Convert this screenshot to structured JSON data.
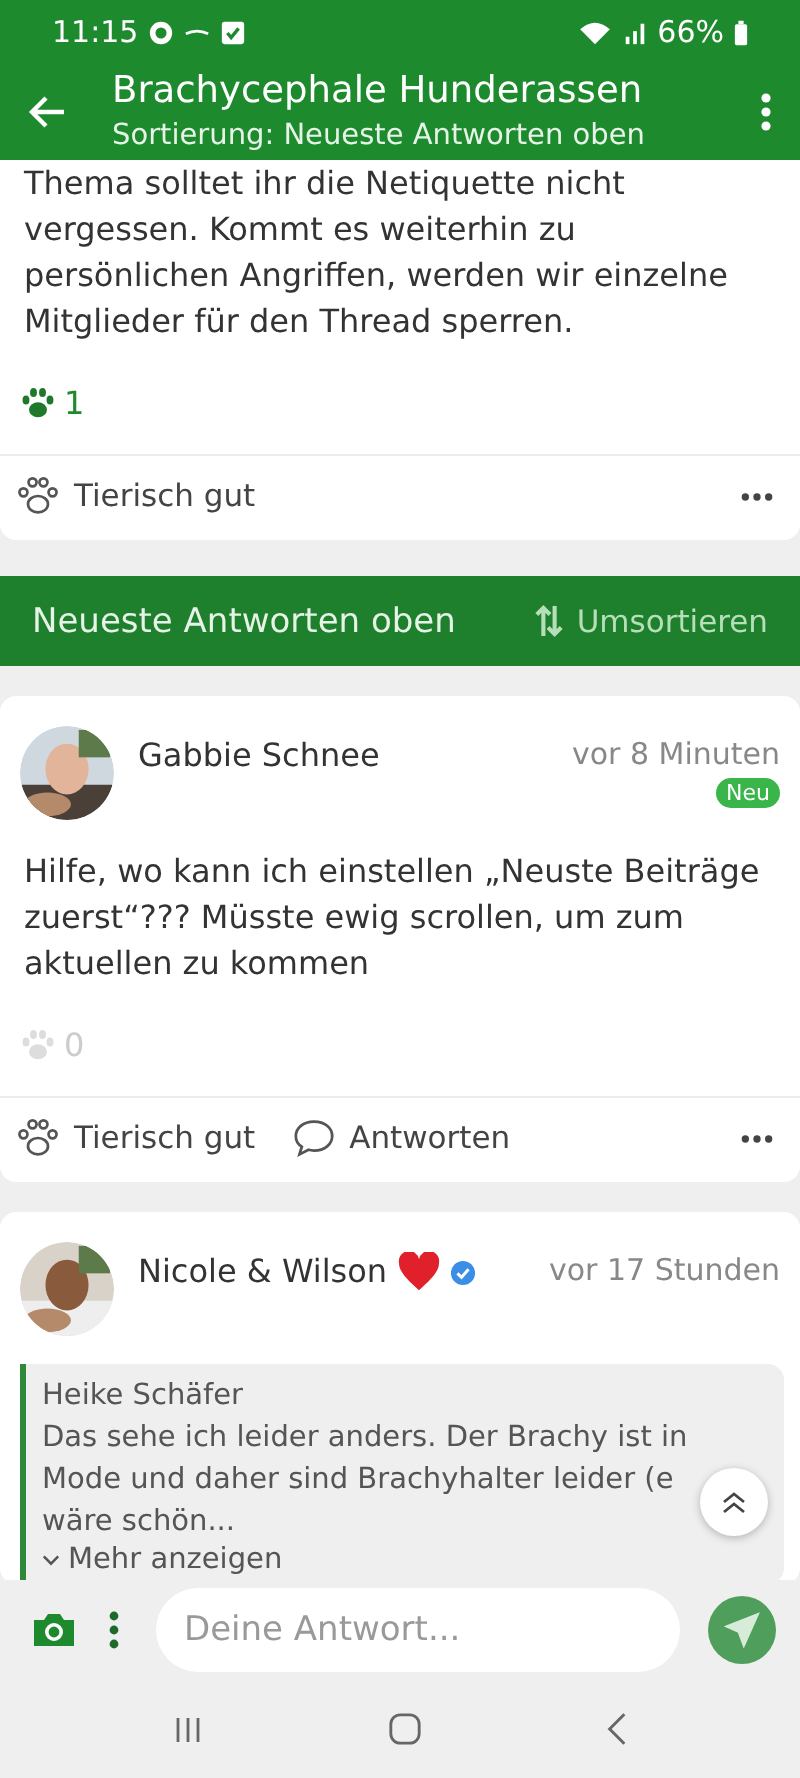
{
  "status_bar": {
    "time": "11:15",
    "battery": "66%"
  },
  "app_bar": {
    "title": "Brachycephale Hunderassen",
    "subtitle": "Sortierung: Neueste Antworten oben"
  },
  "feed": [
    {
      "kind": "post",
      "text": "Thema solltet ihr die Netiquette nicht vergessen. Kommt es weiterhin zu persönlichen Angriffen, werden wir einzelne Mitglieder für den Thread sperren.",
      "likes": "1",
      "liked": true,
      "actions": [
        {
          "kind": "like",
          "label": "Tierisch gut"
        }
      ]
    },
    {
      "kind": "sort_bar",
      "label": "Neueste Antworten oben",
      "button": "Umsortieren"
    },
    {
      "kind": "post",
      "author": "Gabbie Schnee",
      "time": "vor 8 Minuten",
      "badge": "Neu",
      "text": "Hilfe, wo kann ich einstellen „Neuste Beiträge zuerst“??? Müsste ewig scrollen, um zum aktuellen zu kommen",
      "likes": "0",
      "liked": false,
      "actions": [
        {
          "kind": "like",
          "label": "Tierisch gut"
        },
        {
          "kind": "reply",
          "label": "Antworten"
        }
      ]
    },
    {
      "kind": "post",
      "author": "Nicole & Wilson",
      "heart": true,
      "verified": true,
      "time": "vor 17 Stunden",
      "quote": {
        "author": "Heike Schäfer",
        "lines": [
          "Das sehe ich leider anders. Der Brachy ist in",
          "Mode und daher sind Brachyhalter leider (e",
          "wäre schön..."
        ],
        "more": "Mehr anzeigen"
      }
    }
  ],
  "composer": {
    "placeholder": "Deine Antwort..."
  }
}
